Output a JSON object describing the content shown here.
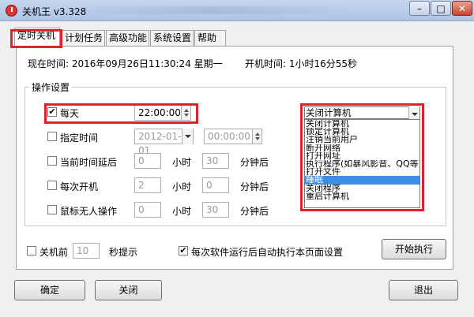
{
  "window": {
    "title": "关机王 v3.328",
    "minimize": "–",
    "maximize": "□",
    "close": "✕"
  },
  "tabs": [
    {
      "label": "定时关机"
    },
    {
      "label": "计划任务"
    },
    {
      "label": "高级功能"
    },
    {
      "label": "系统设置"
    },
    {
      "label": "帮助"
    }
  ],
  "status": {
    "current_time_label": "现在时间: 2016年09月26日11:30:24 星期一",
    "uptime_label": "开机时间: 1小时16分55秒"
  },
  "group": {
    "legend": "操作设置",
    "rows": [
      {
        "label": "每天",
        "checked": "✔"
      },
      {
        "label": "指定时间"
      },
      {
        "label": "当前时间延后"
      },
      {
        "label": "每次开机"
      },
      {
        "label": "鼠标无人操作"
      }
    ],
    "daily_time": "22:00:00",
    "date_value": "2012-01-01",
    "time_value": "00:00:00",
    "delay_hours": "0",
    "delay_minutes": "30",
    "boot_hours": "2",
    "boot_minutes": "0",
    "idle_hours": "0",
    "idle_minutes": "30",
    "unit_hour": "小时",
    "unit_minute_later": "分钟后"
  },
  "action_dropdown": {
    "selected": "关闭计算机",
    "options": [
      "关闭计算机",
      "锁定计算机",
      "注销当前用户",
      "断开网络",
      "打开网址",
      "执行程序(如暴风影音、QQ等)",
      "打开文件",
      "睡眠",
      "关闭程序",
      "重启计算机"
    ],
    "highlighted_index": 7
  },
  "bottom_options": {
    "before_shutdown_label": "关机前",
    "before_shutdown_seconds": "10",
    "seconds_hint": "秒提示",
    "auto_apply_label": "每次软件运行后自动执行本页面设置",
    "auto_apply_checked": "✔",
    "start_button": "开始执行"
  },
  "footer": {
    "ok": "确定",
    "close": "关闭",
    "exit": "退出"
  }
}
